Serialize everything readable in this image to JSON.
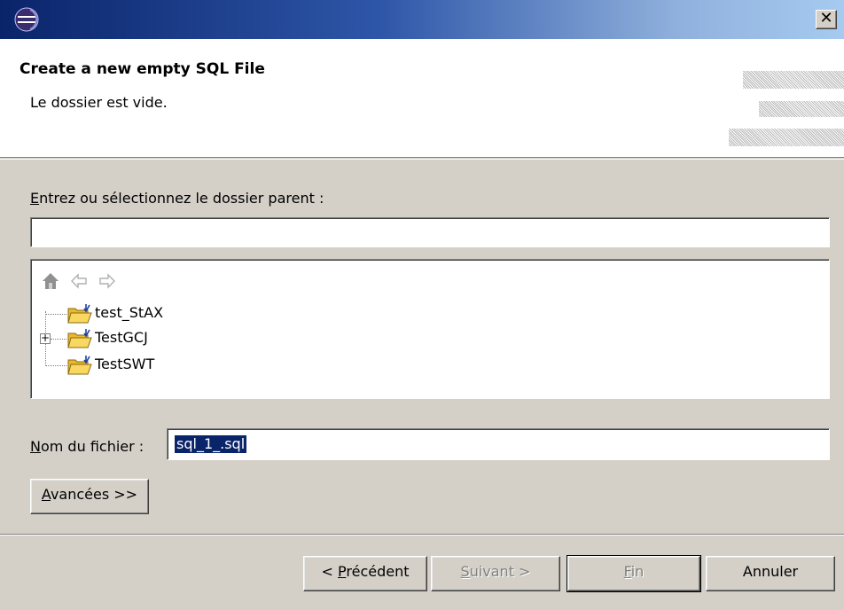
{
  "window": {
    "close_glyph": "✕"
  },
  "header": {
    "title": "Create a new empty SQL File",
    "message": "Le dossier est vide."
  },
  "folder": {
    "label_mnemonic": "E",
    "label_rest": "ntrez ou sélectionnez le dossier parent :",
    "value": ""
  },
  "tree": {
    "toolbar_icons": [
      "home-icon",
      "back-arrow-icon",
      "forward-arrow-icon"
    ],
    "items": [
      {
        "label": "test_StAX",
        "expandable": false
      },
      {
        "label": "TestGCJ",
        "expandable": true
      },
      {
        "label": "TestSWT",
        "expandable": false
      }
    ]
  },
  "file": {
    "label_mnemonic": "N",
    "label_rest": "om du fichier :",
    "value": "sql_1_.sql"
  },
  "buttons": {
    "advanced_mnemonic": "A",
    "advanced_rest": "vancées >>",
    "prev_prefix": "< ",
    "prev_mnemonic": "P",
    "prev_rest": "récédent",
    "next_mnemonic": "S",
    "next_rest": "uivant >",
    "finish_mnemonic": "F",
    "finish_rest": "in",
    "cancel": "Annuler"
  },
  "colors": {
    "title_gradient_start": "#0a246a",
    "title_gradient_end": "#a6caf0",
    "selection": "#0a246a",
    "dialog_bg": "#d4d0c8"
  }
}
